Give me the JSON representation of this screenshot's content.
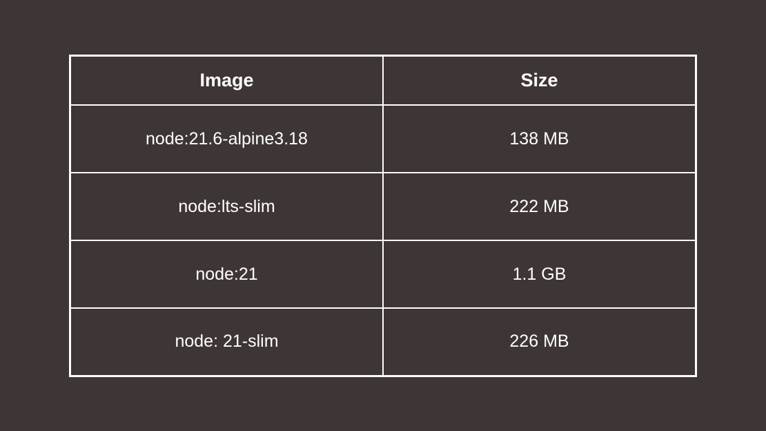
{
  "chart_data": {
    "type": "table",
    "columns": [
      "Image",
      "Size"
    ],
    "rows": [
      {
        "image": "node:21.6-alpine3.18",
        "size": "138 MB"
      },
      {
        "image": "node:lts-slim",
        "size": "222 MB"
      },
      {
        "image": "node:21",
        "size": "1.1 GB"
      },
      {
        "image": "node: 21-slim",
        "size": "226 MB"
      }
    ]
  }
}
